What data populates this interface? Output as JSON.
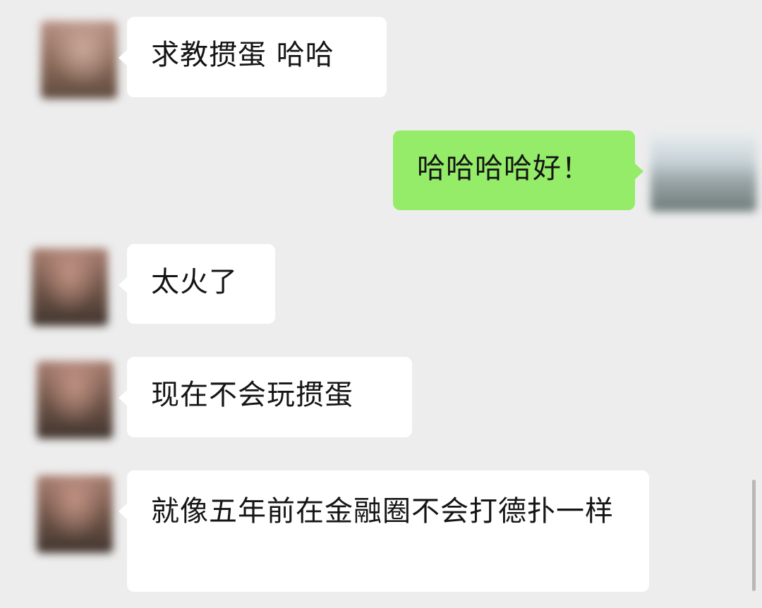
{
  "messages": [
    {
      "sender": "other",
      "text": "求教掼蛋 哈哈"
    },
    {
      "sender": "self",
      "text": "哈哈哈哈好！"
    },
    {
      "sender": "other",
      "text": "太火了"
    },
    {
      "sender": "other",
      "text": "现在不会玩掼蛋"
    },
    {
      "sender": "other",
      "text": "就像五年前在金融圈不会打德扑一样"
    }
  ],
  "colors": {
    "background": "#ededed",
    "incoming_bubble": "#ffffff",
    "outgoing_bubble": "#95ec69"
  }
}
